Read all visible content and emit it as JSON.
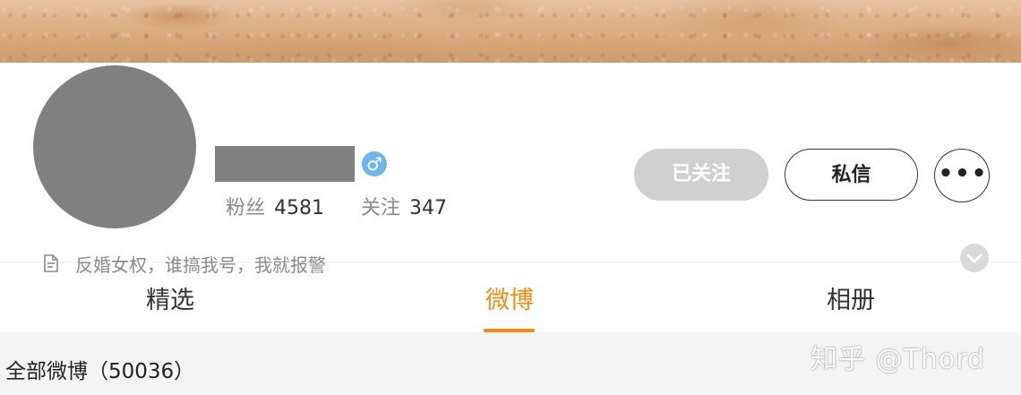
{
  "profile": {
    "gender_symbol": "♂",
    "stats": {
      "fans_label": "粉丝",
      "fans_count": "4581",
      "following_label": "关注",
      "following_count": "347"
    },
    "bio": "反婚女权，谁搞我号，我就报警"
  },
  "actions": {
    "followed_label": "已关注",
    "message_label": "私信",
    "more_symbol": "•••"
  },
  "tabs": [
    {
      "label": "精选",
      "active": false
    },
    {
      "label": "微博",
      "active": true
    },
    {
      "label": "相册",
      "active": false
    }
  ],
  "feed": {
    "count_label": "全部微博（50036）"
  },
  "watermark": "知乎 @Thord",
  "colors": {
    "accent": "#f08c17",
    "gender_badge": "#6cb6ec",
    "followed_button": "#d0d0d0",
    "redaction": "#808080"
  },
  "icons": {
    "gender": "male-icon",
    "bio": "document-icon",
    "expand": "chevron-down-icon",
    "more": "more-dots-icon"
  }
}
